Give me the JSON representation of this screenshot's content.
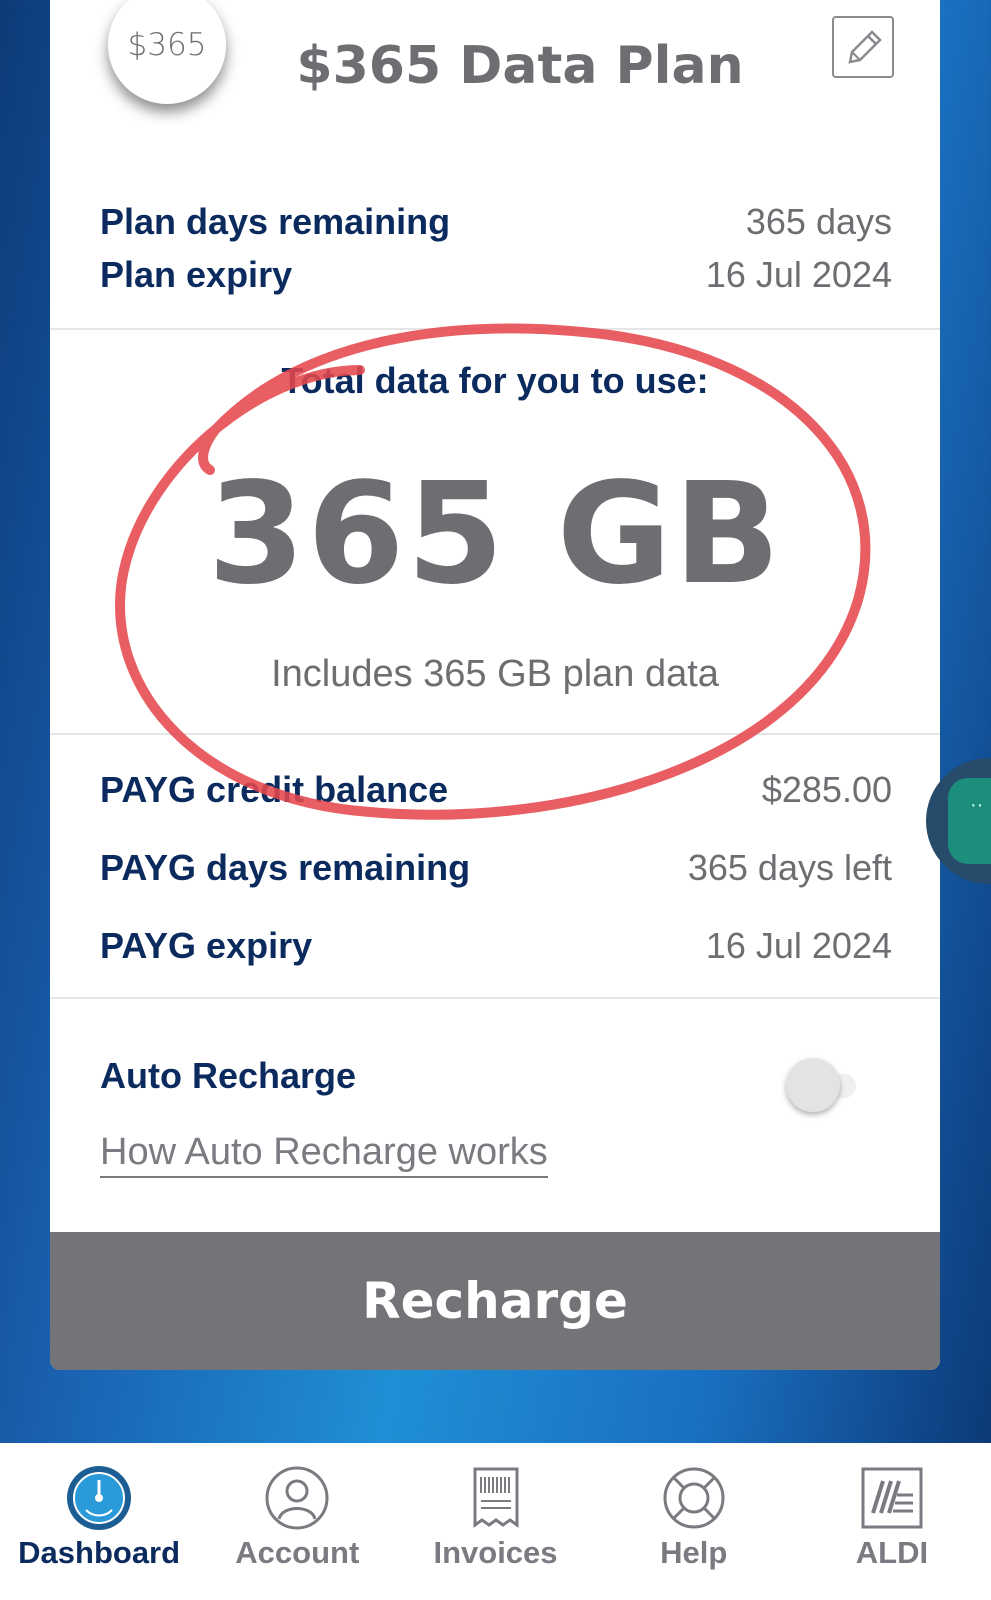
{
  "plan": {
    "badge": "$365",
    "title": "$365 Data Plan",
    "days_remaining_label": "Plan days remaining",
    "days_remaining_value": "365 days",
    "expiry_label": "Plan expiry",
    "expiry_value": "16 Jul 2024"
  },
  "data": {
    "caption": "Total data for you to use:",
    "amount": "365 GB",
    "includes": "Includes 365 GB plan data"
  },
  "payg": {
    "credit_label": "PAYG credit balance",
    "credit_value": "$285.00",
    "days_label": "PAYG days remaining",
    "days_value": "365 days left",
    "expiry_label": "PAYG expiry",
    "expiry_value": "16 Jul 2024"
  },
  "auto_recharge": {
    "label": "Auto Recharge",
    "link": "How Auto Recharge works",
    "enabled": false
  },
  "recharge_button": "Recharge",
  "nav": {
    "items": [
      {
        "label": "Dashboard",
        "icon": "dashboard-icon",
        "active": true
      },
      {
        "label": "Account",
        "icon": "account-icon",
        "active": false
      },
      {
        "label": "Invoices",
        "icon": "invoice-icon",
        "active": false
      },
      {
        "label": "Help",
        "icon": "help-lifebuoy-icon",
        "active": false
      },
      {
        "label": "ALDI",
        "icon": "aldi-logo-icon",
        "active": false
      }
    ]
  },
  "colors": {
    "navy": "#0b2a5e",
    "grey": "#6d6e72",
    "recharge_bg": "#737478",
    "annotation_red": "#e5484d"
  }
}
